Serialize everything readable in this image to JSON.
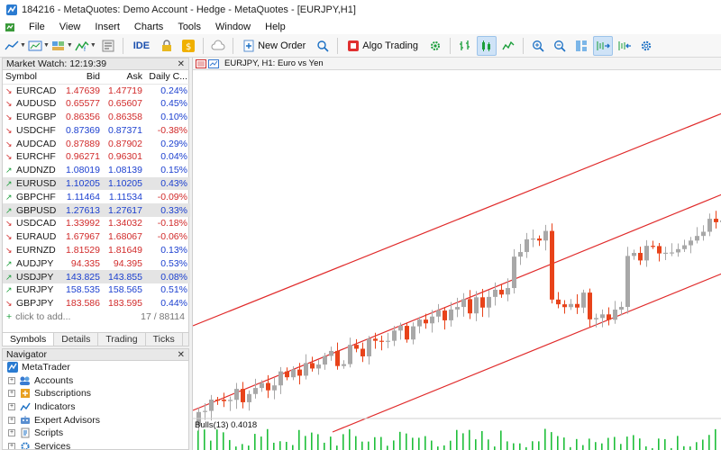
{
  "window": {
    "title": "184216 - MetaQuotes: Demo Account - Hedge - MetaQuotes - [EURJPY,H1]"
  },
  "menu": [
    "File",
    "View",
    "Insert",
    "Charts",
    "Tools",
    "Window",
    "Help"
  ],
  "toolbar": {
    "ide_label": "IDE",
    "new_order_label": "New Order",
    "algo_trading_label": "Algo Trading"
  },
  "market_watch": {
    "title": "Market Watch: 12:19:39",
    "columns": [
      "Symbol",
      "Bid",
      "Ask",
      "Daily C..."
    ],
    "rows": [
      {
        "symbol": "EURCAD",
        "bid": "1.47639",
        "ask": "1.47719",
        "change": "0.24%",
        "arrow": "down",
        "price_dir": "down",
        "change_dir": "up"
      },
      {
        "symbol": "AUDUSD",
        "bid": "0.65577",
        "ask": "0.65607",
        "change": "0.45%",
        "arrow": "down",
        "price_dir": "down",
        "change_dir": "up"
      },
      {
        "symbol": "EURGBP",
        "bid": "0.86356",
        "ask": "0.86358",
        "change": "0.10%",
        "arrow": "down",
        "price_dir": "down",
        "change_dir": "up"
      },
      {
        "symbol": "USDCHF",
        "bid": "0.87369",
        "ask": "0.87371",
        "change": "-0.38%",
        "arrow": "down",
        "price_dir": "up",
        "change_dir": "down"
      },
      {
        "symbol": "AUDCAD",
        "bid": "0.87889",
        "ask": "0.87902",
        "change": "0.29%",
        "arrow": "down",
        "price_dir": "down",
        "change_dir": "up"
      },
      {
        "symbol": "EURCHF",
        "bid": "0.96271",
        "ask": "0.96301",
        "change": "0.04%",
        "arrow": "down",
        "price_dir": "down",
        "change_dir": "up"
      },
      {
        "symbol": "AUDNZD",
        "bid": "1.08019",
        "ask": "1.08139",
        "change": "0.15%",
        "arrow": "up",
        "price_dir": "up",
        "change_dir": "up"
      },
      {
        "symbol": "EURUSD",
        "bid": "1.10205",
        "ask": "1.10205",
        "change": "0.43%",
        "arrow": "up",
        "price_dir": "up",
        "change_dir": "up",
        "highlight": true
      },
      {
        "symbol": "GBPCHF",
        "bid": "1.11464",
        "ask": "1.11534",
        "change": "-0.09%",
        "arrow": "up",
        "price_dir": "up",
        "change_dir": "down"
      },
      {
        "symbol": "GBPUSD",
        "bid": "1.27613",
        "ask": "1.27617",
        "change": "0.33%",
        "arrow": "up",
        "price_dir": "up",
        "change_dir": "up",
        "highlight": true
      },
      {
        "symbol": "USDCAD",
        "bid": "1.33992",
        "ask": "1.34032",
        "change": "-0.18%",
        "arrow": "down",
        "price_dir": "down",
        "change_dir": "down"
      },
      {
        "symbol": "EURAUD",
        "bid": "1.67967",
        "ask": "1.68067",
        "change": "-0.06%",
        "arrow": "down",
        "price_dir": "down",
        "change_dir": "down"
      },
      {
        "symbol": "EURNZD",
        "bid": "1.81529",
        "ask": "1.81649",
        "change": "0.13%",
        "arrow": "down",
        "price_dir": "down",
        "change_dir": "up"
      },
      {
        "symbol": "AUDJPY",
        "bid": "94.335",
        "ask": "94.395",
        "change": "0.53%",
        "arrow": "up",
        "price_dir": "down",
        "change_dir": "up"
      },
      {
        "symbol": "USDJPY",
        "bid": "143.825",
        "ask": "143.855",
        "change": "0.08%",
        "arrow": "up",
        "price_dir": "up",
        "change_dir": "up",
        "highlight": true
      },
      {
        "symbol": "EURJPY",
        "bid": "158.535",
        "ask": "158.565",
        "change": "0.51%",
        "arrow": "up",
        "price_dir": "up",
        "change_dir": "up"
      },
      {
        "symbol": "GBPJPY",
        "bid": "183.586",
        "ask": "183.595",
        "change": "0.44%",
        "arrow": "down",
        "price_dir": "down",
        "change_dir": "up"
      }
    ],
    "add_label": "click to add...",
    "count": "17 / 88114",
    "tabs": [
      "Symbols",
      "Details",
      "Trading",
      "Ticks"
    ]
  },
  "navigator": {
    "title": "Navigator",
    "items": [
      "MetaTrader",
      "Accounts",
      "Subscriptions",
      "Indicators",
      "Expert Advisors",
      "Scripts",
      "Services"
    ]
  },
  "chart": {
    "tab_title": "EURJPY, H1:  Euro vs Yen",
    "indicator_caption": "Bulls(13) 0.4018"
  },
  "colors": {
    "bull": "#a8a8a8",
    "bear": "#e8431a",
    "channel": "#e02a2a",
    "volume": "#1fbf3a",
    "accent": "#1b3fcf"
  }
}
